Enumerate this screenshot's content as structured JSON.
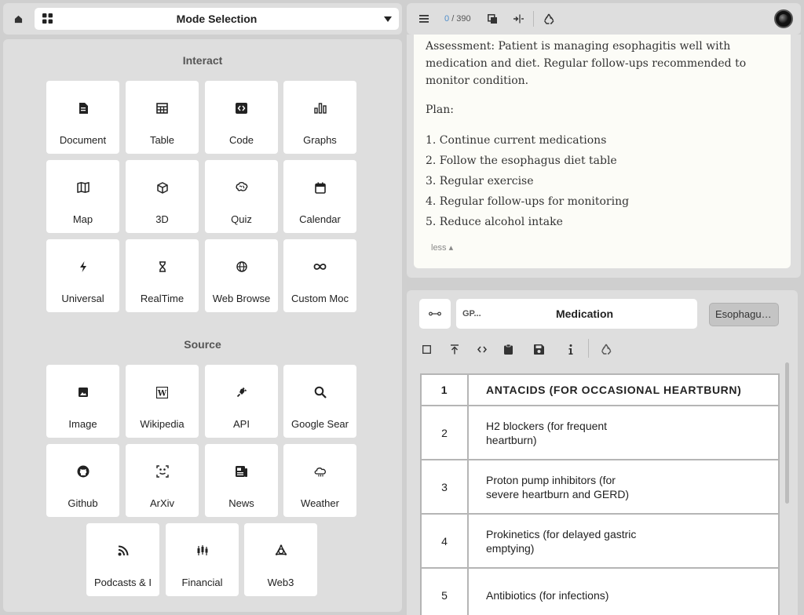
{
  "mode_bar": {
    "title": "Mode Selection"
  },
  "interact": {
    "title": "Interact",
    "tiles": [
      {
        "label": "Document",
        "icon": "document-icon"
      },
      {
        "label": "Table",
        "icon": "table-icon"
      },
      {
        "label": "Code",
        "icon": "code-icon"
      },
      {
        "label": "Graphs",
        "icon": "graphs-icon"
      },
      {
        "label": "Map",
        "icon": "map-icon"
      },
      {
        "label": "3D",
        "icon": "cube-icon"
      },
      {
        "label": "Quiz",
        "icon": "brain-icon"
      },
      {
        "label": "Calendar",
        "icon": "calendar-icon"
      },
      {
        "label": "Universal",
        "icon": "bolt-icon"
      },
      {
        "label": "RealTime",
        "icon": "hourglass-icon"
      },
      {
        "label": "Web Browse",
        "icon": "globe-icon"
      },
      {
        "label": "Custom Moc",
        "icon": "infinity-icon"
      }
    ]
  },
  "source": {
    "title": "Source",
    "tiles": [
      {
        "label": "Image",
        "icon": "image-icon"
      },
      {
        "label": "Wikipedia",
        "icon": "wikipedia-icon"
      },
      {
        "label": "API",
        "icon": "plug-icon"
      },
      {
        "label": "Google Sear",
        "icon": "search-icon"
      },
      {
        "label": "Github",
        "icon": "github-icon"
      },
      {
        "label": "ArXiv",
        "icon": "arxiv-icon"
      },
      {
        "label": "News",
        "icon": "news-icon"
      },
      {
        "label": "Weather",
        "icon": "cloud-icon"
      },
      {
        "label": "Podcasts & I",
        "icon": "rss-icon"
      },
      {
        "label": "Financial",
        "icon": "candlestick-icon"
      },
      {
        "label": "Web3",
        "icon": "web3-icon"
      }
    ]
  },
  "doc_toolbar": {
    "current": "0",
    "total": "/ 390"
  },
  "document": {
    "assessment": "Assessment: Patient is managing esophagitis well with medication and diet. Regular follow-ups recommended to monitor condition.",
    "plan_label": "Plan:",
    "plan_items": [
      "1. Continue current medications",
      "2. Follow the esophagus diet table",
      "3. Regular exercise",
      "4. Regular follow-ups for monitoring",
      "5. Reduce alcohol intake"
    ],
    "less_label": "less"
  },
  "medication": {
    "model": "GP...",
    "name": "Medication",
    "tag": "Esophagus..."
  },
  "table": {
    "rows": [
      {
        "num": "1",
        "text": "ANTACIDS (FOR OCCASIONAL HEARTBURN)"
      },
      {
        "num": "2",
        "text": "H2 blockers (for frequent heartburn)"
      },
      {
        "num": "3",
        "text": "Proton pump inhibitors (for severe heartburn and GERD)"
      },
      {
        "num": "4",
        "text": "Prokinetics (for delayed gastric emptying)"
      },
      {
        "num": "5",
        "text": "Antibiotics (for infections)"
      }
    ]
  },
  "colors": {
    "accent": "#4f8ecb",
    "panel": "#dedede",
    "background": "#cfcfcf",
    "card": "#fcfcf7"
  }
}
